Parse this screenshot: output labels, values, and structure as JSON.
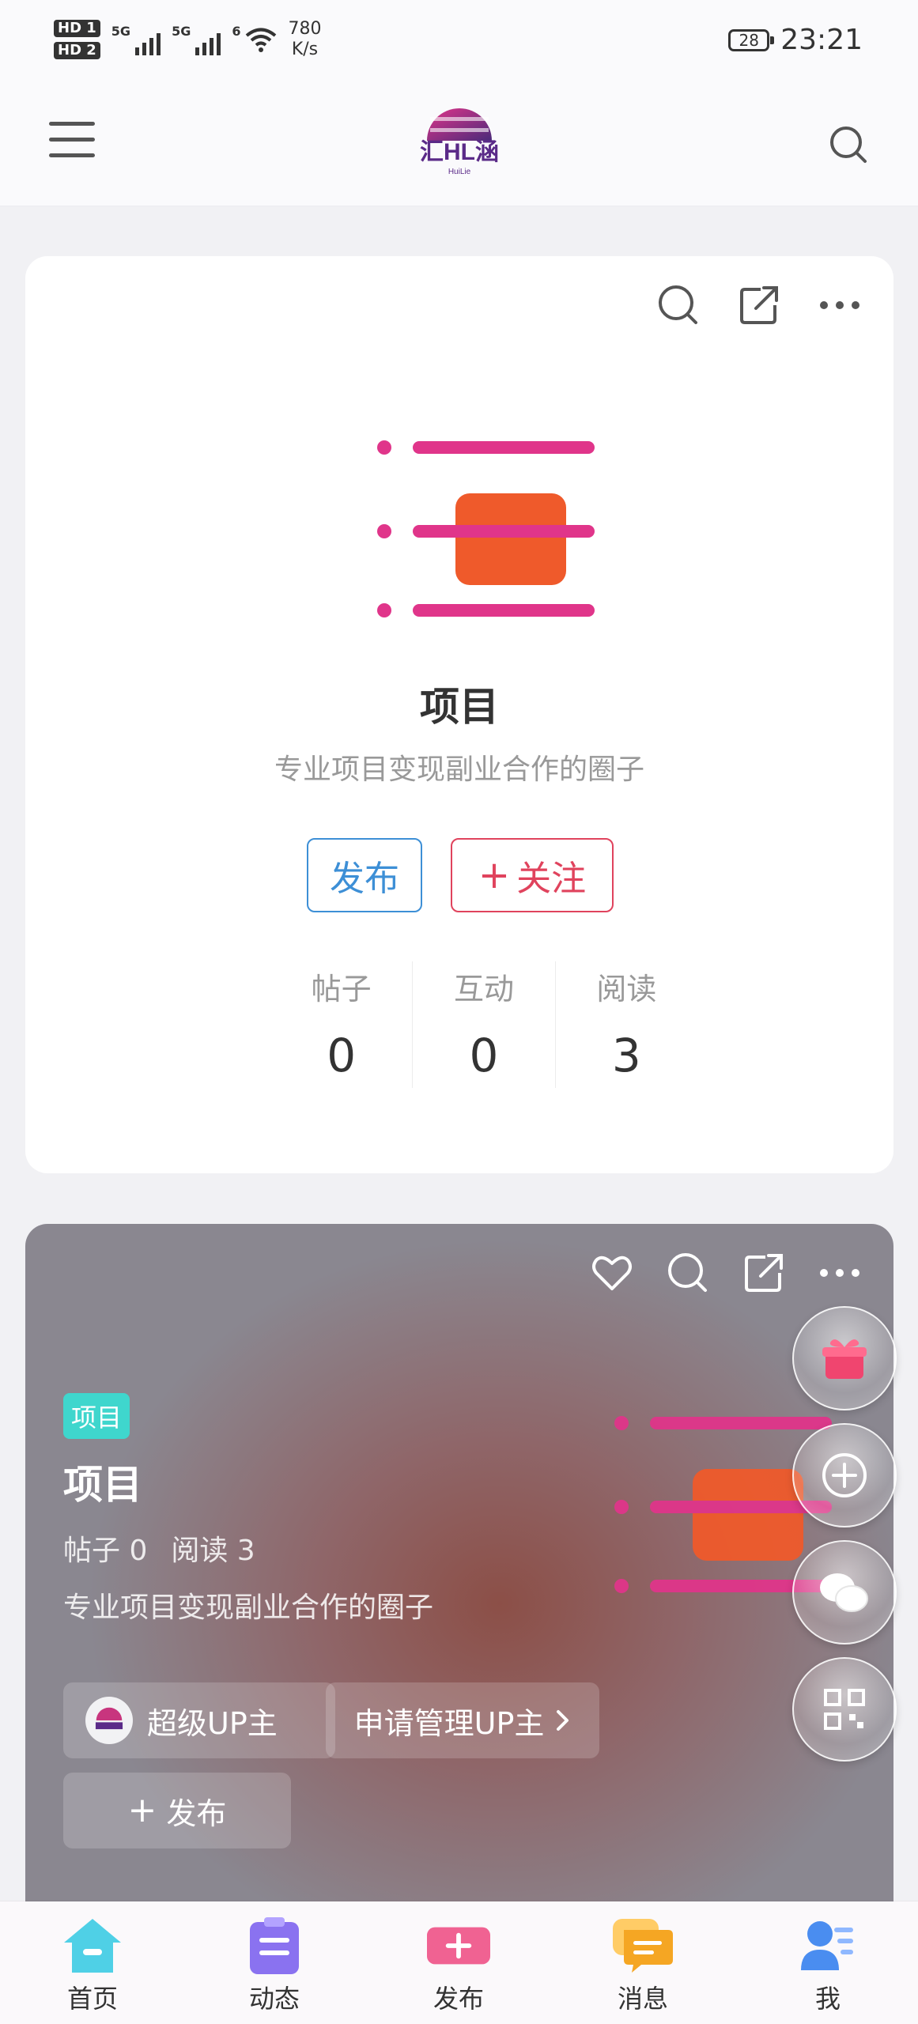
{
  "status_bar": {
    "hd1": "HD 1",
    "hd2": "HD 2",
    "sig1_label": "5G",
    "sig2_label": "5G",
    "wifi_label": "6",
    "speed_value": "780",
    "speed_unit": "K/s",
    "battery": "28",
    "time": "23:21"
  },
  "header": {
    "logo_text": "汇HL涵",
    "logo_sub": "HuiLie"
  },
  "circle": {
    "title": "项目",
    "description": "专业项目变现副业合作的圈子",
    "publish_label": "发布",
    "follow_label": "关注",
    "stats": [
      {
        "label": "帖子",
        "value": "0"
      },
      {
        "label": "互动",
        "value": "0"
      },
      {
        "label": "阅读",
        "value": "3"
      }
    ]
  },
  "card2": {
    "tag": "项目",
    "title": "项目",
    "posts_label": "帖子 0",
    "reads_label": "阅读 3",
    "description": "专业项目变现副业合作的圈子",
    "super_up_label": "超级UP主",
    "apply_label": "申请管理UP主",
    "post_label": "发布"
  },
  "bottom_nav": [
    {
      "label": "首页",
      "icon": "home-icon",
      "color": "#4fd0e6"
    },
    {
      "label": "动态",
      "icon": "clipboard-icon",
      "color": "#8a72f0"
    },
    {
      "label": "发布",
      "icon": "plus-icon",
      "color": "#f06292"
    },
    {
      "label": "消息",
      "icon": "chat-icon",
      "color": "#f5a623"
    },
    {
      "label": "我",
      "icon": "person-icon",
      "color": "#4a8df0"
    }
  ],
  "colors": {
    "accent_blue": "#3d8fd6",
    "accent_red": "#e0435d",
    "brand_pink": "#e0358a",
    "brand_orange": "#ef5a2b",
    "tag_teal": "#3fd6cd"
  }
}
